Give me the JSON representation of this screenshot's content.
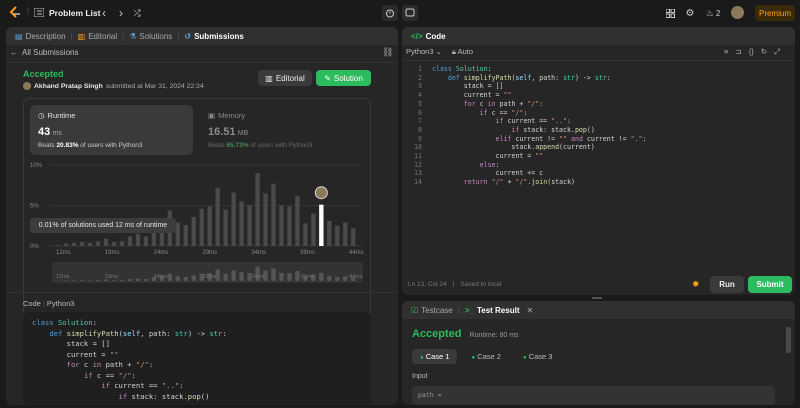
{
  "topbar": {
    "problem_list": "Problem List",
    "streak_count": "2",
    "premium": "Premium"
  },
  "left_tabs": {
    "description": "Description",
    "editorial": "Editorial",
    "solutions": "Solutions",
    "submissions": "Submissions"
  },
  "submissions": {
    "back": "All Submissions",
    "status": "Accepted",
    "user": "Akhand Pratap Singh",
    "submitted_at": "submitted at Mar 31, 2024 22:34",
    "editorial_btn": "Editorial",
    "solution_btn": "Solution",
    "runtime": {
      "label": "Runtime",
      "value": "43",
      "unit": "ms",
      "beats_prefix": "Beats",
      "beats_pct": "20.83%",
      "beats_suffix": "of users with Python3"
    },
    "memory": {
      "label": "Memory",
      "value": "16.51",
      "unit": "MB",
      "beats_prefix": "Beats",
      "beats_pct": "65.73%",
      "beats_suffix": "of users with Python3"
    },
    "tooltip": "0.01% of solutions used 12 ms of runtime",
    "code_label": "Code",
    "code_lang": "Python3"
  },
  "chart_data": {
    "type": "bar",
    "yticks": [
      "10%",
      "5%",
      "0%"
    ],
    "ylim": [
      0,
      10
    ],
    "xticks": [
      "12ms",
      "19ms",
      "24ms",
      "29ms",
      "34ms",
      "39ms",
      "44ms"
    ],
    "values": [
      0.1,
      0.3,
      0.4,
      0.5,
      0.4,
      0.6,
      0.9,
      0.5,
      0.6,
      1.2,
      1.5,
      1.2,
      2.5,
      3.2,
      4.4,
      2.9,
      2.6,
      3.6,
      4.6,
      4.9,
      7.2,
      4.5,
      6.6,
      5.5,
      5.0,
      9.0,
      6.5,
      7.7,
      5.0,
      4.9,
      6.2,
      2.8,
      4.0,
      5.1,
      3.1,
      2.5,
      2.9,
      2.2
    ],
    "highlight_index": 33
  },
  "left_code": [
    "class Solution:",
    "    def simplifyPath(self, path: str) -> str:",
    "        stack = []",
    "        current = \"\"",
    "        for c in path + \"/\":",
    "            if c == \"/\":",
    "                if current == \"..\":",
    "                    if stack: stack.pop()"
  ],
  "right_code": {
    "tab": "Code",
    "lang": "Python3",
    "auto": "Auto",
    "status": "Ln 13, Col 24",
    "saved": "Saved to local",
    "lines": [
      "class Solution:",
      "    def simplifyPath(self, path: str) -> str:",
      "        stack = []",
      "        current = \"\"",
      "        for c in path + \"/\":",
      "            if c == \"/\":",
      "                if current == \"..\":",
      "                    if stack: stack.pop()",
      "                elif current != \"\" and current != \".\":",
      "                    stack.append(current)",
      "                current = \"\"",
      "            else:",
      "                current += c",
      "        return \"/\" + \"/\".join(stack)"
    ],
    "run": "Run",
    "submit": "Submit"
  },
  "test": {
    "testcase_tab": "Testcase",
    "result_tab": "Test Result",
    "status": "Accepted",
    "runtime": "Runtime: 80 ms",
    "cases": [
      "Case 1",
      "Case 2",
      "Case 3"
    ],
    "input_label": "Input",
    "input_value": "path ="
  }
}
